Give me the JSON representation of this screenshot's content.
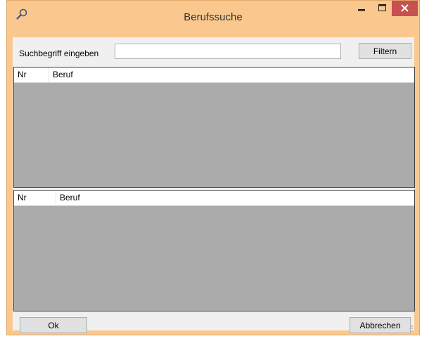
{
  "window": {
    "title": "Berufssuche",
    "icon": "search-icon",
    "controls": [
      "minimize-icon",
      "maximize-icon",
      "close-icon"
    ],
    "frame_color": "#fac88e",
    "close_color": "#c75050"
  },
  "search": {
    "label": "Suchbegriff eingeben",
    "value": "",
    "placeholder": "",
    "filter_label": "Filtern"
  },
  "grid_top": {
    "columns": [
      "Nr",
      "Beruf"
    ],
    "rows": []
  },
  "grid_bottom": {
    "columns": [
      "Nr",
      "Beruf"
    ],
    "rows": []
  },
  "footer": {
    "ok_label": "Ok",
    "cancel_label": "Abbrechen"
  }
}
